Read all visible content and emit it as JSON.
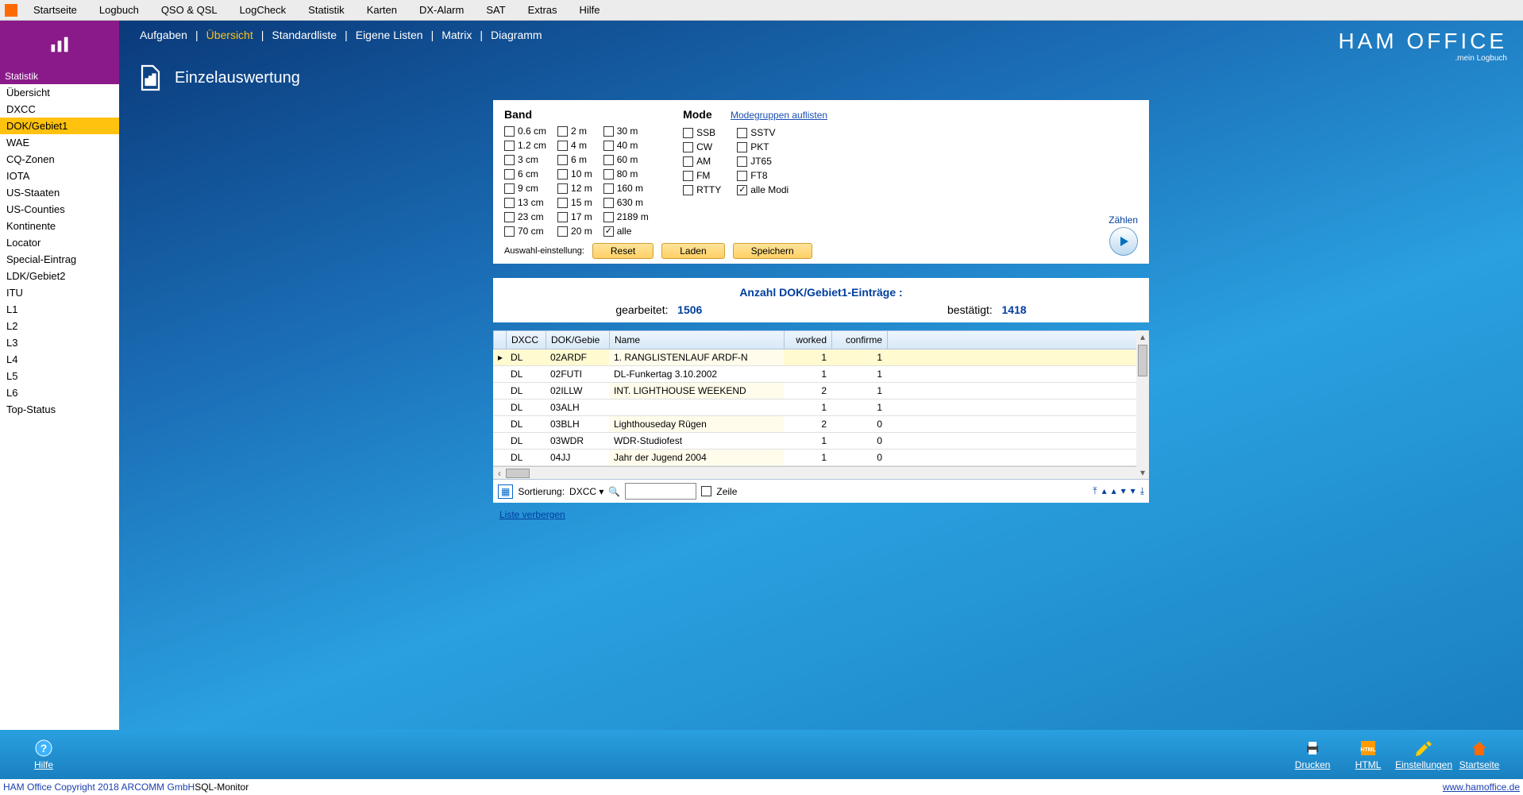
{
  "topmenu": [
    "Startseite",
    "Logbuch",
    "QSO & QSL",
    "LogCheck",
    "Statistik",
    "Karten",
    "DX-Alarm",
    "SAT",
    "Extras",
    "Hilfe"
  ],
  "sidebar": {
    "title": "Statistik",
    "items": [
      "Übersicht",
      "DXCC",
      "DOK/Gebiet1",
      "WAE",
      "CQ-Zonen",
      "IOTA",
      "US-Staaten",
      "US-Counties",
      "Kontinente",
      "Locator",
      "Special-Eintrag",
      "LDK/Gebiet2",
      "ITU",
      "L1",
      "L2",
      "L3",
      "L4",
      "L5",
      "L6",
      "Top-Status"
    ],
    "active": "DOK/Gebiet1"
  },
  "tabs": {
    "items": [
      "Aufgaben",
      "Übersicht",
      "Standardliste",
      "Eigene Listen",
      "Matrix",
      "Diagramm"
    ],
    "active": "Übersicht"
  },
  "brand": {
    "name": "HAM OFFICE",
    "sub": ".mein Logbuch"
  },
  "section_title": "Einzelauswertung",
  "filter": {
    "band_label": "Band",
    "mode_label": "Mode",
    "mode_link": "Modegruppen auflisten",
    "bands_col1": [
      "0.6 cm",
      "1.2 cm",
      "3 cm",
      "6 cm",
      "9 cm",
      "13 cm",
      "23 cm",
      "70 cm"
    ],
    "bands_col2": [
      "2 m",
      "4 m",
      "6 m",
      "10 m",
      "12 m",
      "15 m",
      "17 m",
      "20 m"
    ],
    "bands_col3": [
      "30 m",
      "40 m",
      "60 m",
      "80 m",
      "160 m",
      "630 m",
      "2189 m",
      "alle"
    ],
    "bands_checked": [
      "alle"
    ],
    "modes_col1": [
      "SSB",
      "CW",
      "AM",
      "FM",
      "RTTY"
    ],
    "modes_col2": [
      "SSTV",
      "PKT",
      "JT65",
      "FT8",
      "alle Modi"
    ],
    "modes_checked": [
      "alle Modi"
    ],
    "selection_label": "Auswahl-einstellung:",
    "btn_reset": "Reset",
    "btn_load": "Laden",
    "btn_save": "Speichern",
    "btn_count": "Zählen"
  },
  "counts": {
    "title": "Anzahl DOK/Gebiet1-Einträge :",
    "worked_label": "gearbeitet:",
    "worked_value": "1506",
    "confirmed_label": "bestätigt:",
    "confirmed_value": "1418"
  },
  "table": {
    "columns": [
      "DXCC",
      "DOK/Gebie",
      "Name",
      "worked",
      "confirme"
    ],
    "rows": [
      {
        "dxcc": "DL",
        "dok": "02ARDF",
        "name": "1. RANGLISTENLAUF ARDF-N",
        "worked": "1",
        "confirmed": "1",
        "sel": true
      },
      {
        "dxcc": "DL",
        "dok": "02FUTI",
        "name": "DL-Funkertag 3.10.2002",
        "worked": "1",
        "confirmed": "1"
      },
      {
        "dxcc": "DL",
        "dok": "02ILLW",
        "name": "INT. LIGHTHOUSE WEEKEND",
        "worked": "2",
        "confirmed": "1"
      },
      {
        "dxcc": "DL",
        "dok": "03ALH",
        "name": "",
        "worked": "1",
        "confirmed": "1"
      },
      {
        "dxcc": "DL",
        "dok": "03BLH",
        "name": "Lighthouseday Rügen",
        "worked": "2",
        "confirmed": "0"
      },
      {
        "dxcc": "DL",
        "dok": "03WDR",
        "name": "WDR-Studiofest",
        "worked": "1",
        "confirmed": "0"
      },
      {
        "dxcc": "DL",
        "dok": "04JJ",
        "name": "Jahr der Jugend 2004",
        "worked": "1",
        "confirmed": "0"
      }
    ],
    "sort_label": "Sortierung:",
    "sort_value": "DXCC",
    "zeile_label": "Zeile",
    "hide_link": "Liste verbergen"
  },
  "bottombar": {
    "help": "Hilfe",
    "print": "Drucken",
    "html": "HTML",
    "settings": "Einstellungen",
    "home": "Startseite"
  },
  "status": {
    "copyright": "HAM Office Copyright 2018 ARCOMM GmbH",
    "sql": "SQL-Monitor",
    "url": "www.hamoffice.de"
  }
}
